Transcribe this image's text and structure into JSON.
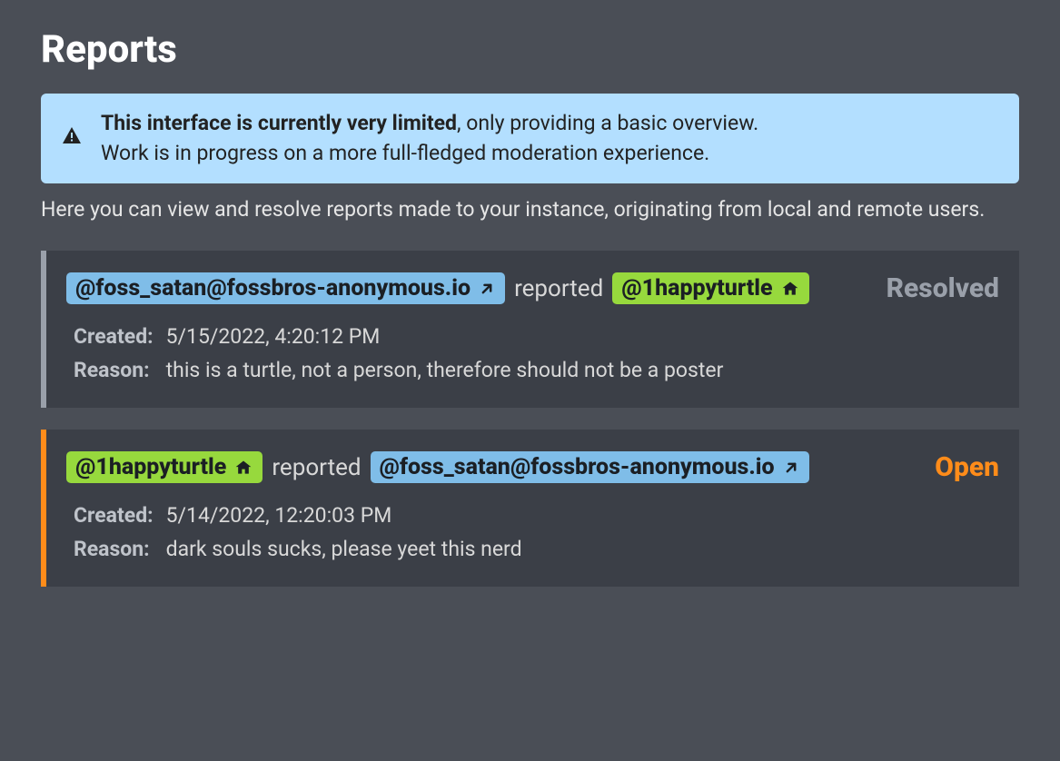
{
  "page_title": "Reports",
  "banner": {
    "strong": "This interface is currently very limited",
    "rest1": ", only providing a basic overview.",
    "line2": "Work is in progress on a more full-fledged moderation experience."
  },
  "intro": "Here you can view and resolve reports made to your instance, originating from local and remote users.",
  "verb": "reported",
  "labels": {
    "created": "Created:",
    "reason": "Reason:"
  },
  "reports": [
    {
      "status": "Resolved",
      "status_class": "resolved",
      "reporter": {
        "handle": "@foss_satan@fossbros-anonymous.io",
        "type": "remote"
      },
      "target": {
        "handle": "@1happyturtle",
        "type": "local"
      },
      "created": "5/15/2022, 4:20:12 PM",
      "reason": "this is a turtle, not a person, therefore should not be a poster"
    },
    {
      "status": "Open",
      "status_class": "open",
      "reporter": {
        "handle": "@1happyturtle",
        "type": "local"
      },
      "target": {
        "handle": "@foss_satan@fossbros-anonymous.io",
        "type": "remote"
      },
      "created": "5/14/2022, 12:20:03 PM",
      "reason": "dark souls sucks, please yeet this nerd"
    }
  ]
}
